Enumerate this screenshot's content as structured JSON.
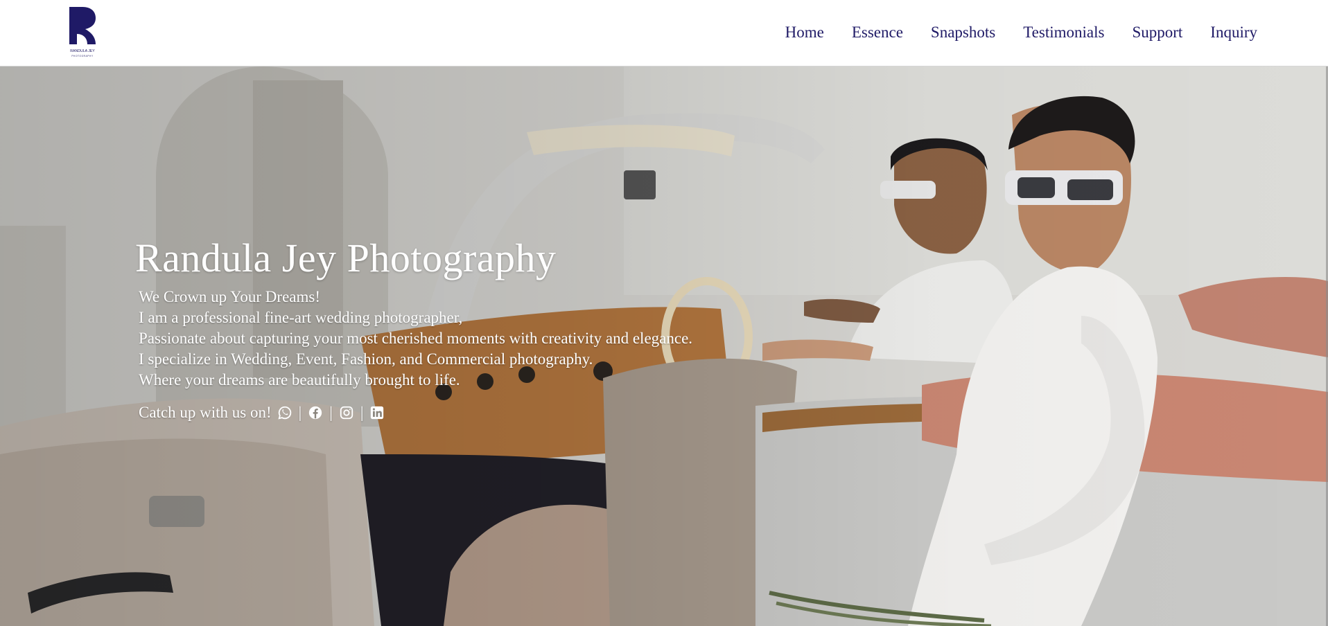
{
  "brand": {
    "name": "RANDULA JEY",
    "tagline": "PHOTOGRAPHY",
    "colors": {
      "primary": "#1f1a66",
      "header_bg": "#ffffff",
      "hero_text": "#ffffff"
    }
  },
  "nav": {
    "items": [
      {
        "label": "Home"
      },
      {
        "label": "Essence"
      },
      {
        "label": "Snapshots"
      },
      {
        "label": "Testimonials"
      },
      {
        "label": "Support"
      },
      {
        "label": "Inquiry"
      }
    ]
  },
  "hero": {
    "title": "Randula Jey Photography",
    "lines": [
      "We Crown up Your Dreams!",
      "I am a professional fine-art wedding photographer,",
      "Passionate about capturing your most cherished moments with creativity and elegance.",
      "I specialize in Wedding, Event, Fashion, and Commercial photography.",
      "Where your dreams are beautifully brought to life."
    ],
    "social": {
      "label": "Catch up with us on!",
      "separator": "|",
      "icons": [
        "whatsapp-icon",
        "facebook-icon",
        "instagram-icon",
        "linkedin-icon"
      ]
    }
  }
}
